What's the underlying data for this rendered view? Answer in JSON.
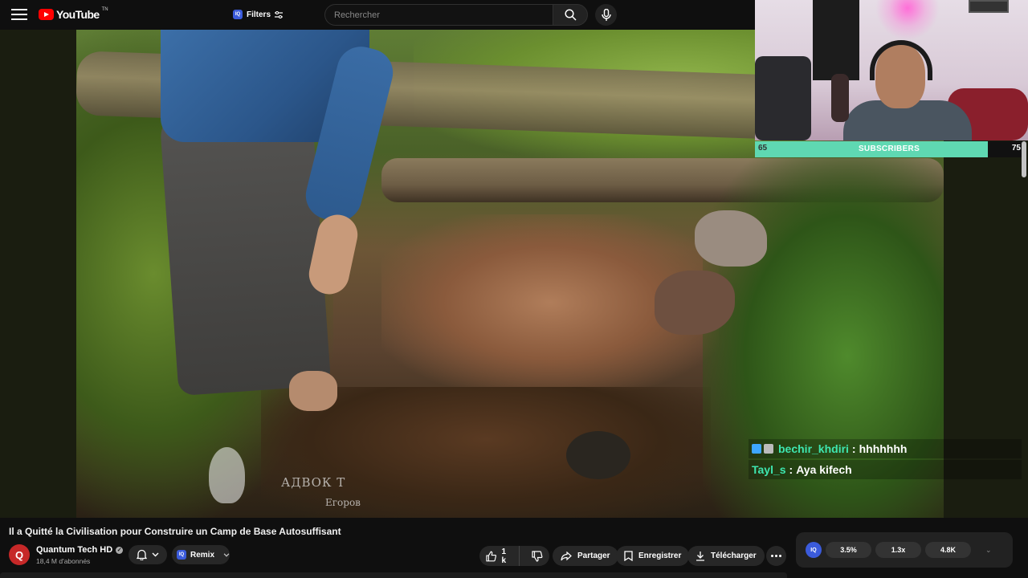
{
  "header": {
    "logo_text": "YouTube",
    "logo_sup": "TN",
    "filters_badge": "IQ",
    "filters_label": "Filters",
    "search_placeholder": "Rechercher"
  },
  "video": {
    "watermark_line1": "АДВОК Т",
    "watermark_line2": "Егоров"
  },
  "subscriber_bar": {
    "left_value": "65",
    "label": "SUBSCRIBERS",
    "right_value": "75",
    "progress": 0.867
  },
  "chat": [
    {
      "user": "bechir_khdiri",
      "message": "hhhhhhh",
      "badges": true
    },
    {
      "user": "Tayl_s",
      "message": "Aya kifech",
      "badges": false
    }
  ],
  "video_info": {
    "title": "Il a Quitté la Civilisation pour Construire un Camp de Base Autosuffisant",
    "channel_name": "Quantum Tech HD",
    "channel_initial": "Q",
    "subscribers": "18,4 M d'abonnés",
    "remix_badge": "IQ",
    "remix_label": "Remix"
  },
  "actions": {
    "like_count": "1 k",
    "share_label": "Partager",
    "save_label": "Enregistrer",
    "download_label": "Télécharger"
  },
  "stats": {
    "badge": "IQ",
    "values": [
      "3.5%",
      "1.3x",
      "4.8K"
    ]
  },
  "colors": {
    "subscriber_fill": "#5fd8b2",
    "chat_username": "#3ee6b0",
    "youtube_red": "#ff0000"
  }
}
